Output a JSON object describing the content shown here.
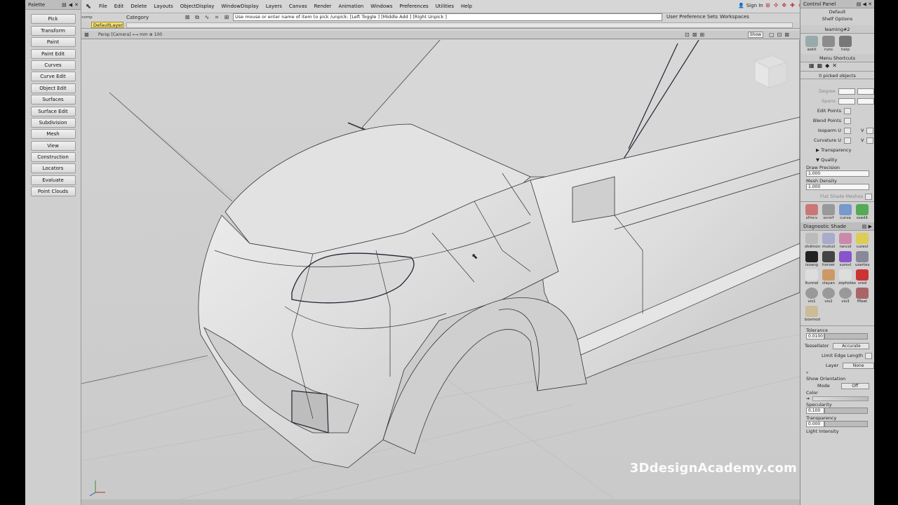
{
  "palette": {
    "title": "Palette",
    "items": [
      "Pick",
      "Transform",
      "Paint",
      "Paint Edit",
      "Curves",
      "Curve Edit",
      "Object Edit",
      "Surfaces",
      "Surface Edit",
      "Subdivision",
      "Mesh",
      "View",
      "Construction",
      "Locators",
      "Evaluate",
      "Point Clouds"
    ]
  },
  "menubar": {
    "tool_label": "comp",
    "items": [
      "File",
      "Edit",
      "Delete",
      "Layouts",
      "ObjectDisplay",
      "WindowDisplay",
      "Layers",
      "Canvas",
      "Render",
      "Animation",
      "Windows",
      "Preferences",
      "Utilities",
      "Help"
    ],
    "sign_in": "Sign In"
  },
  "toolbar": {
    "category": "Category",
    "prompt": "Use mouse or enter name of item to pick /unpick: [Left Toggle ] [Middle Add ] [Right Unpick ]",
    "user_pref_sets": "User Preference Sets",
    "workspaces": "Workspaces",
    "layer": "DefaultLayer"
  },
  "viewport": {
    "title": "Persp [Camera] ⟷ mm  ⊕ 100",
    "show_button": "Show",
    "watermark": "3DdesignAcademy.com"
  },
  "control_panel": {
    "title": "Control Panel",
    "preset": "Default",
    "shelf_options": "Shelf Options",
    "shelf_tab": "learning#2",
    "shelf_tools": [
      "askit",
      "runs",
      "help"
    ],
    "menu_shortcuts": "Menu Shortcuts",
    "picked": "0 picked objects",
    "degree": "Degree",
    "spans": "Spans",
    "edit_points": "Edit Points",
    "blend_points": "Blend Points",
    "isoparm_u": "Isoparm U",
    "curvature_u": "Curvature U",
    "v_label": "V",
    "transparency_section": "Transparency",
    "quality_section": "Quality",
    "draw_precision": "Draw Precision",
    "draw_precision_val": "1.000",
    "mesh_density": "Mesh Density",
    "mesh_density_val": "1.000",
    "flat_shade": "Flat Shade Meshes",
    "tools2": [
      "sfmcv",
      "scrsrf",
      "curva",
      "ssedit"
    ],
    "diag_title": "Diagnostic Shade",
    "diag_tools": [
      "shdmon",
      "mulcol",
      "rancol",
      "curevl",
      "isoang",
      "horver",
      "surevl",
      "usertex",
      "ltunnel",
      "clayan",
      "zophotes",
      "vred",
      "vis1",
      "vis2",
      "vis3",
      "ffleet",
      "bosmod"
    ],
    "tolerance": "Tolerance",
    "tolerance_val": "0.0100",
    "tessellator": "Tessellator",
    "tessellator_val": "Accurate",
    "limit_edge": "Limit Edge Length",
    "layer_label": "Layer",
    "layer_val": "None",
    "show_orientation": "Show Orientation",
    "mode": "Mode",
    "mode_val": "Off",
    "color": "Color",
    "specularity": "Specularity",
    "specularity_val": "0.100",
    "transparency": "Transparency",
    "transparency_val": "0.000",
    "light_intensity": "Light Intensity"
  }
}
